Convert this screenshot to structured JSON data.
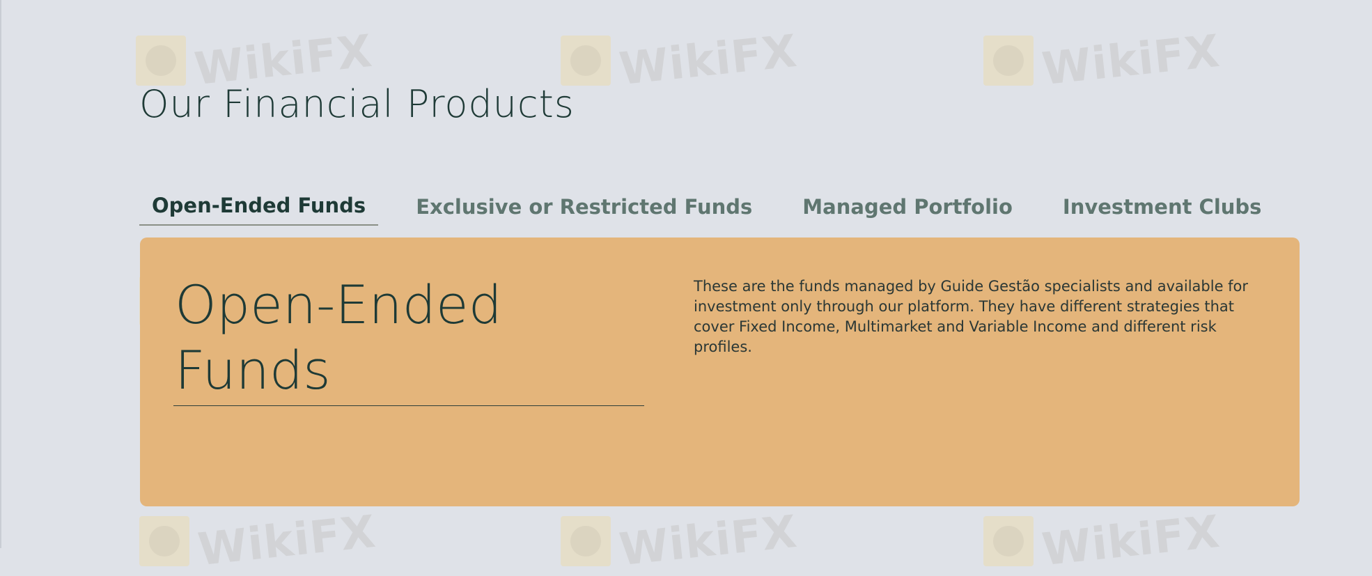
{
  "page": {
    "title": "Our Financial Products"
  },
  "tabs": [
    {
      "label": "Open-Ended Funds",
      "active": true
    },
    {
      "label": "Exclusive or Restricted Funds",
      "active": false
    },
    {
      "label": "Managed Portfolio",
      "active": false
    },
    {
      "label": "Investment Clubs",
      "active": false
    }
  ],
  "panel": {
    "heading": "Open-Ended Funds",
    "description": "These are the funds managed by Guide Gestão specialists and available for investment only through our platform. They have different strategies that cover Fixed Income, Multimarket and Variable Income and different risk profiles."
  },
  "watermark": {
    "text": "WikiFX"
  },
  "colors": {
    "background": "#dfe2e8",
    "panel": "#e4b57b",
    "text_dark": "#1e3a36",
    "tab_inactive": "#5f7670"
  }
}
